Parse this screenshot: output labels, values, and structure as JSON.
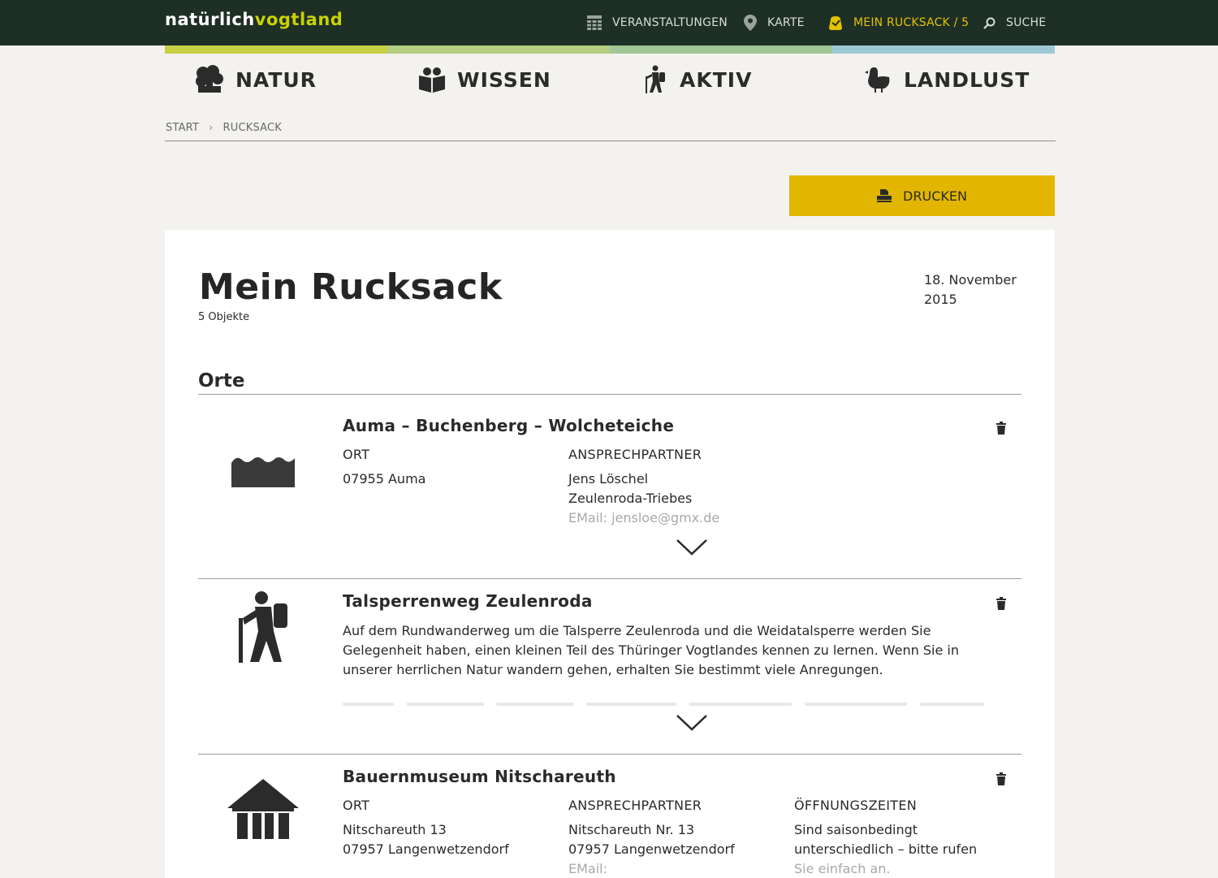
{
  "header": {
    "logo_part1": "natürlich",
    "logo_part2": "vogtland",
    "nav": {
      "events": "VERANSTALTUNGEN",
      "map": "KARTE",
      "rucksack": "MEIN RUCKSACK / 5",
      "search": "SUCHE"
    }
  },
  "colors": {
    "topbar": "#1e2f26",
    "accent_yellow": "#e2b600",
    "strip": [
      "#c9cf45",
      "#b4cd7e",
      "#9fc694",
      "#9dc9d6"
    ]
  },
  "categories": {
    "natur": "NATUR",
    "wissen": "WISSEN",
    "aktiv": "AKTIV",
    "landlust": "LANDLUST"
  },
  "breadcrumb": {
    "start": "START",
    "separator": "›",
    "current": "RUCKSACK"
  },
  "print_button": "DRUCKEN",
  "page": {
    "title": "Mein Rucksack",
    "count": "5 Objekte",
    "date": "18. November 2015",
    "section": "Orte"
  },
  "items": [
    {
      "icon": "wave-landscape-icon",
      "title": "Auma – Buchenberg – Wolcheteiche",
      "ort_label": "ORT",
      "ort": "07955 Auma",
      "contact_label": "ANSPRECHPARTNER",
      "contact_name": "Jens Löschel",
      "contact_city": "Zeulenroda-Triebes",
      "contact_email": "EMail: jensloe@gmx.de"
    },
    {
      "icon": "hiker-icon",
      "title": "Talsperrenweg Zeulenroda",
      "description": "Auf dem Rundwanderweg um die Talsperre Zeulenroda und die Weidatalsperre werden Sie Gelegenheit haben, einen kleinen Teil des Thüringer Vogtlandes kennen zu lernen. Wenn Sie in unserer herrlichen Natur wandern gehen, erhalten Sie bestimmt viele Anregungen."
    },
    {
      "icon": "museum-icon",
      "title": "Bauernmuseum Nitschareuth",
      "ort_label": "ORT",
      "ort_line1": "Nitschareuth 13",
      "ort_line2": "07957 Langenwetzendorf",
      "contact_label": "ANSPRECHPARTNER",
      "contact_line1": "Nitschareuth Nr. 13",
      "contact_line2": "07957 Langenwetzendorf",
      "contact_line3": "EMail:",
      "hours_label": "ÖFFNUNGSZEITEN",
      "hours_line1": "Sind saisonbedingt",
      "hours_line2": "unterschiedlich – bitte rufen",
      "hours_line3": "Sie einfach an."
    }
  ]
}
